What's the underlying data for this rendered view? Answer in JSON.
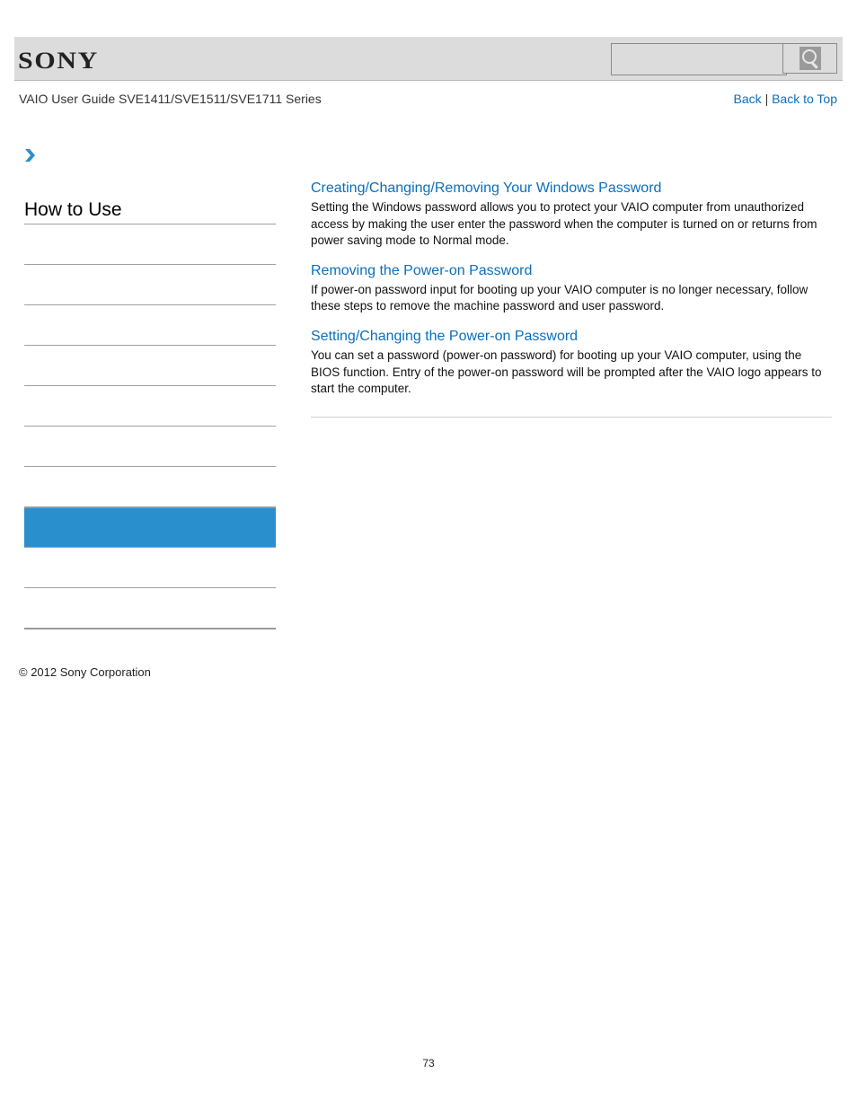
{
  "header": {
    "brand": "SONY",
    "search": {
      "placeholder": "",
      "value": "",
      "button_icon": "search-icon"
    }
  },
  "guide_title": "VAIO User Guide SVE1411/SVE1511/SVE1711 Series",
  "nav": {
    "back": "Back",
    "separator": "|",
    "back_to_top": "Back to Top"
  },
  "breadcrumb_icon": "chevron-right-icon",
  "sidebar": {
    "title": "How to Use",
    "items": [
      {
        "label": "",
        "active": false
      },
      {
        "label": "",
        "active": false
      },
      {
        "label": "",
        "active": false
      },
      {
        "label": "",
        "active": false
      },
      {
        "label": "",
        "active": false
      },
      {
        "label": "",
        "active": false
      },
      {
        "label": "",
        "active": false
      },
      {
        "label": "",
        "active": true
      },
      {
        "label": "",
        "active": false
      },
      {
        "label": "",
        "active": false
      }
    ],
    "active_color": "#2a8fcd"
  },
  "topics": [
    {
      "title": "Creating/Changing/Removing Your Windows Password",
      "description": "Setting the Windows password allows you to protect your VAIO computer from unauthorized access by making the user enter the password when the computer is turned on or returns from power saving mode to Normal mode."
    },
    {
      "title": "Removing the Power-on Password",
      "description": "If power-on password input for booting up your VAIO computer is no longer necessary, follow these steps to remove the machine password and user password."
    },
    {
      "title": "Setting/Changing the Power-on Password",
      "description": "You can set a password (power-on password) for booting up your VAIO computer, using the BIOS function. Entry of the power-on password will be prompted after the VAIO logo appears to start the computer."
    }
  ],
  "copyright": "© 2012 Sony Corporation",
  "page_number": "73",
  "colors": {
    "link": "#0b6fbd",
    "header_bg": "#dcdcdc"
  }
}
